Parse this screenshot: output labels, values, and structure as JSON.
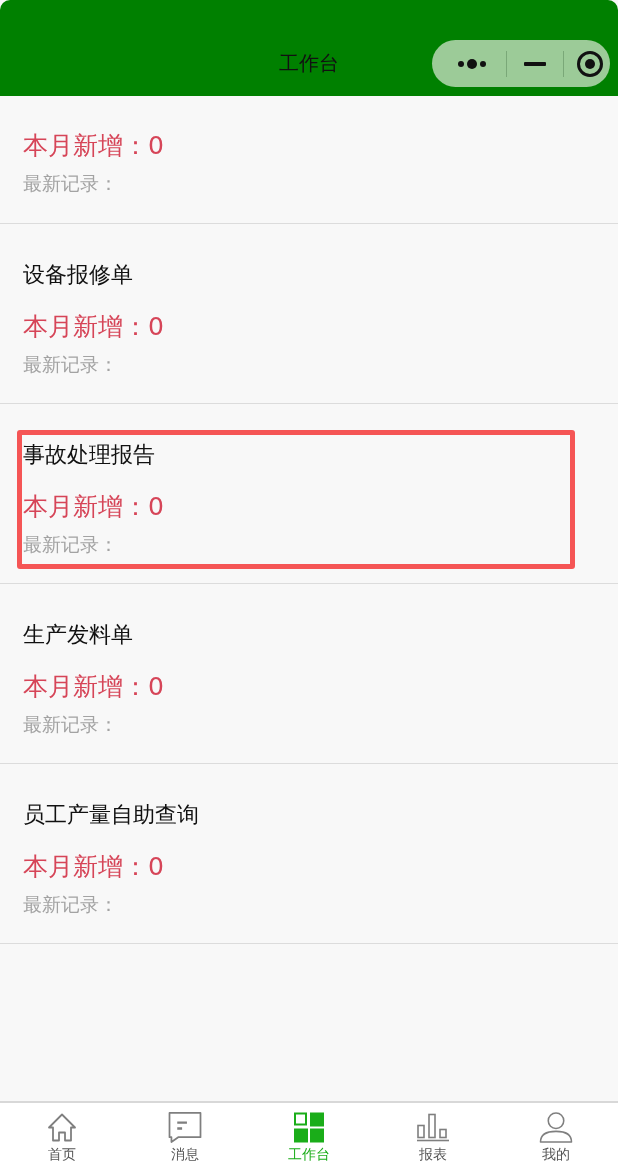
{
  "header": {
    "title": "工作台"
  },
  "cards": [
    {
      "count": "本月新增：0",
      "latest": "最新记录：",
      "highlighted": false
    },
    {
      "title": "设备报修单",
      "count": "本月新增：0",
      "latest": "最新记录：",
      "highlighted": false
    },
    {
      "title": "事故处理报告",
      "count": "本月新增：0",
      "latest": "最新记录：",
      "highlighted": true
    },
    {
      "title": "生产发料单",
      "count": "本月新增：0",
      "latest": "最新记录：",
      "highlighted": false
    },
    {
      "title": "员工产量自助查询",
      "count": "本月新增：0",
      "latest": "最新记录：",
      "highlighted": false
    }
  ],
  "tabbar": [
    {
      "label": "首页",
      "selected": false
    },
    {
      "label": "消息",
      "selected": false
    },
    {
      "label": "工作台",
      "selected": true
    },
    {
      "label": "报表",
      "selected": false
    },
    {
      "label": "我的",
      "selected": false
    }
  ]
}
